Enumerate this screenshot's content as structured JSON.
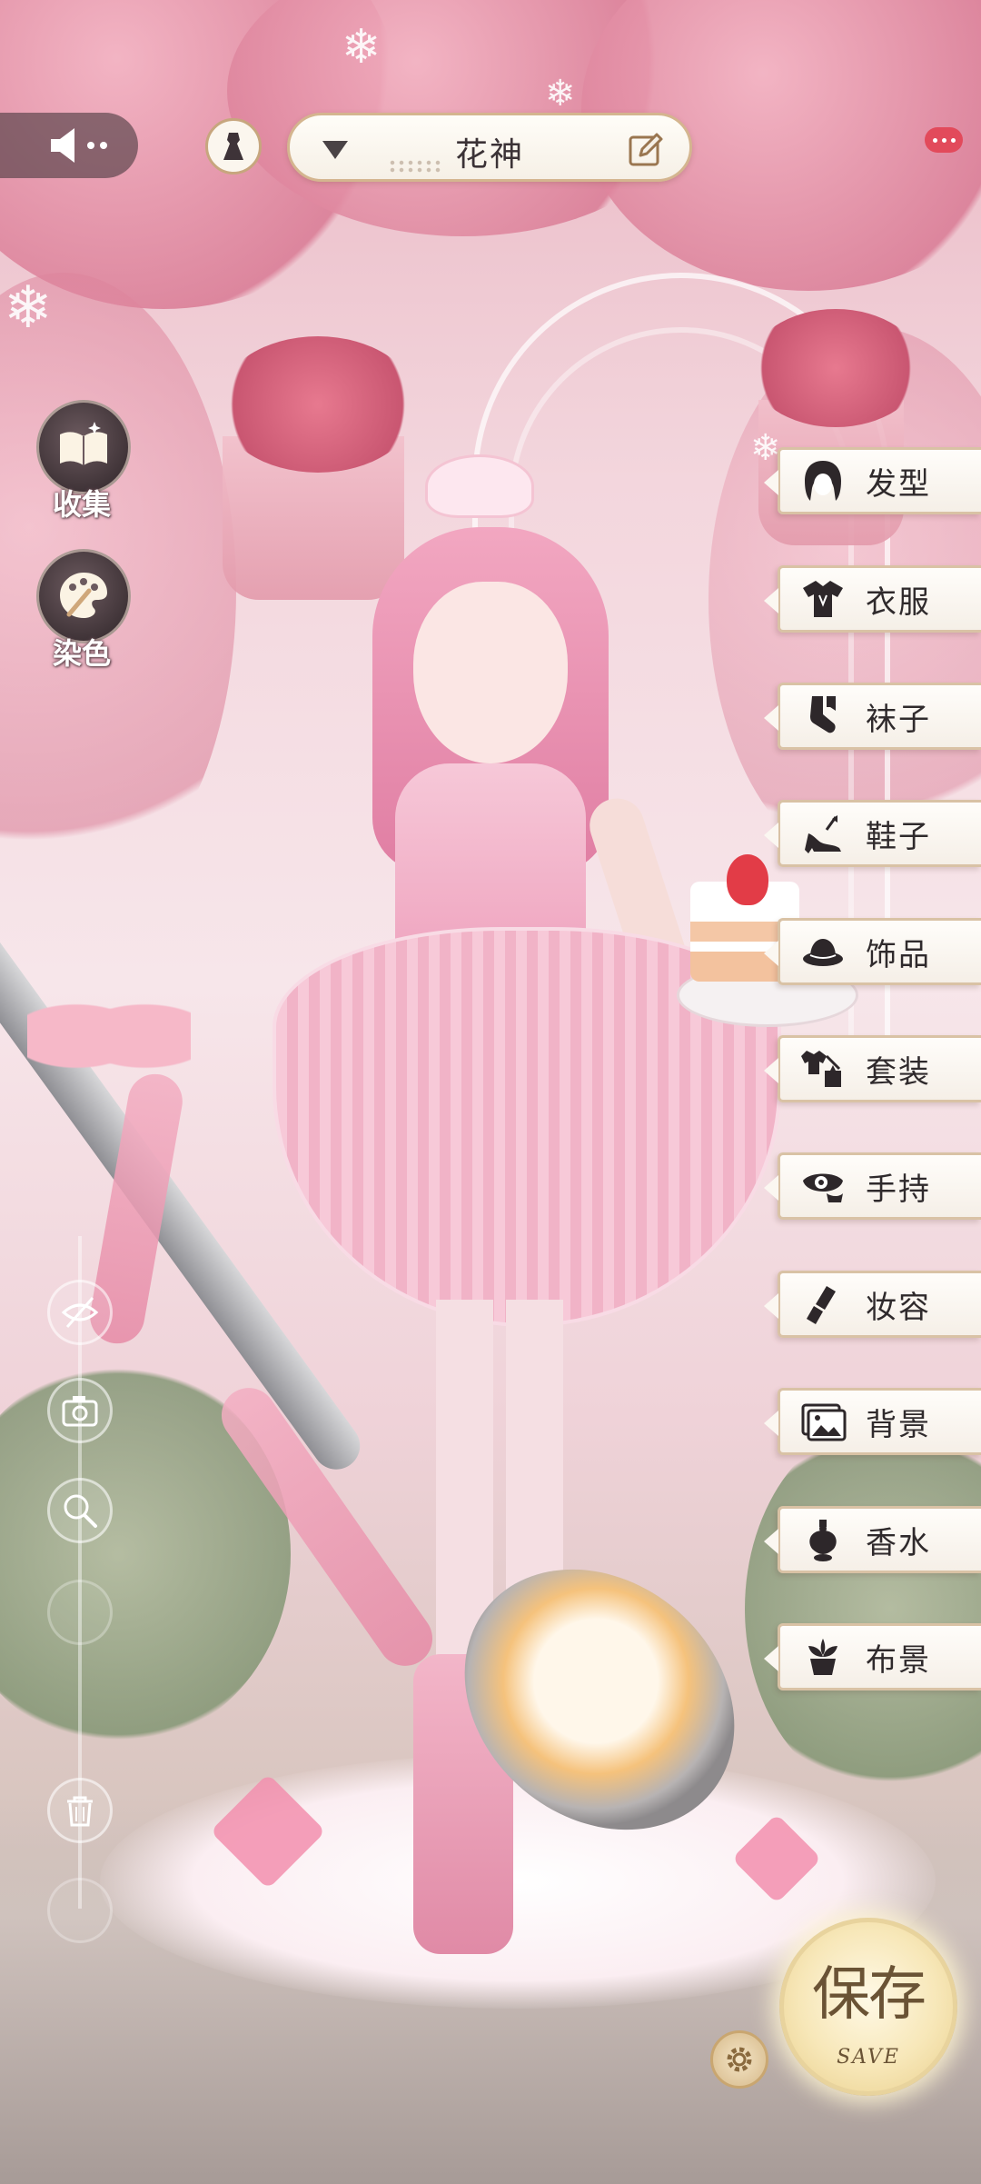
{
  "header": {
    "outfit_name": "花神"
  },
  "left_panel": {
    "collect_label": "收集",
    "dye_label": "染色"
  },
  "category_tabs": [
    {
      "label": "发型",
      "icon": "hairstyle-icon"
    },
    {
      "label": "衣服",
      "icon": "clothes-icon"
    },
    {
      "label": "袜子",
      "icon": "socks-icon"
    },
    {
      "label": "鞋子",
      "icon": "shoes-icon"
    },
    {
      "label": "饰品",
      "icon": "accessory-icon"
    },
    {
      "label": "套装",
      "icon": "suit-icon"
    },
    {
      "label": "手持",
      "icon": "handheld-icon"
    },
    {
      "label": "妆容",
      "icon": "makeup-icon"
    },
    {
      "label": "背景",
      "icon": "background-icon"
    },
    {
      "label": "香水",
      "icon": "perfume-icon"
    },
    {
      "label": "布景",
      "icon": "scenery-icon"
    }
  ],
  "save": {
    "label_cn": "保存",
    "label_en": "SAVE"
  },
  "colors": {
    "accent_gold": "#d4b58f",
    "tab_bg": "#fffdfa",
    "save_gold": "#f7e7b8",
    "notification_red": "#e24a5b"
  }
}
